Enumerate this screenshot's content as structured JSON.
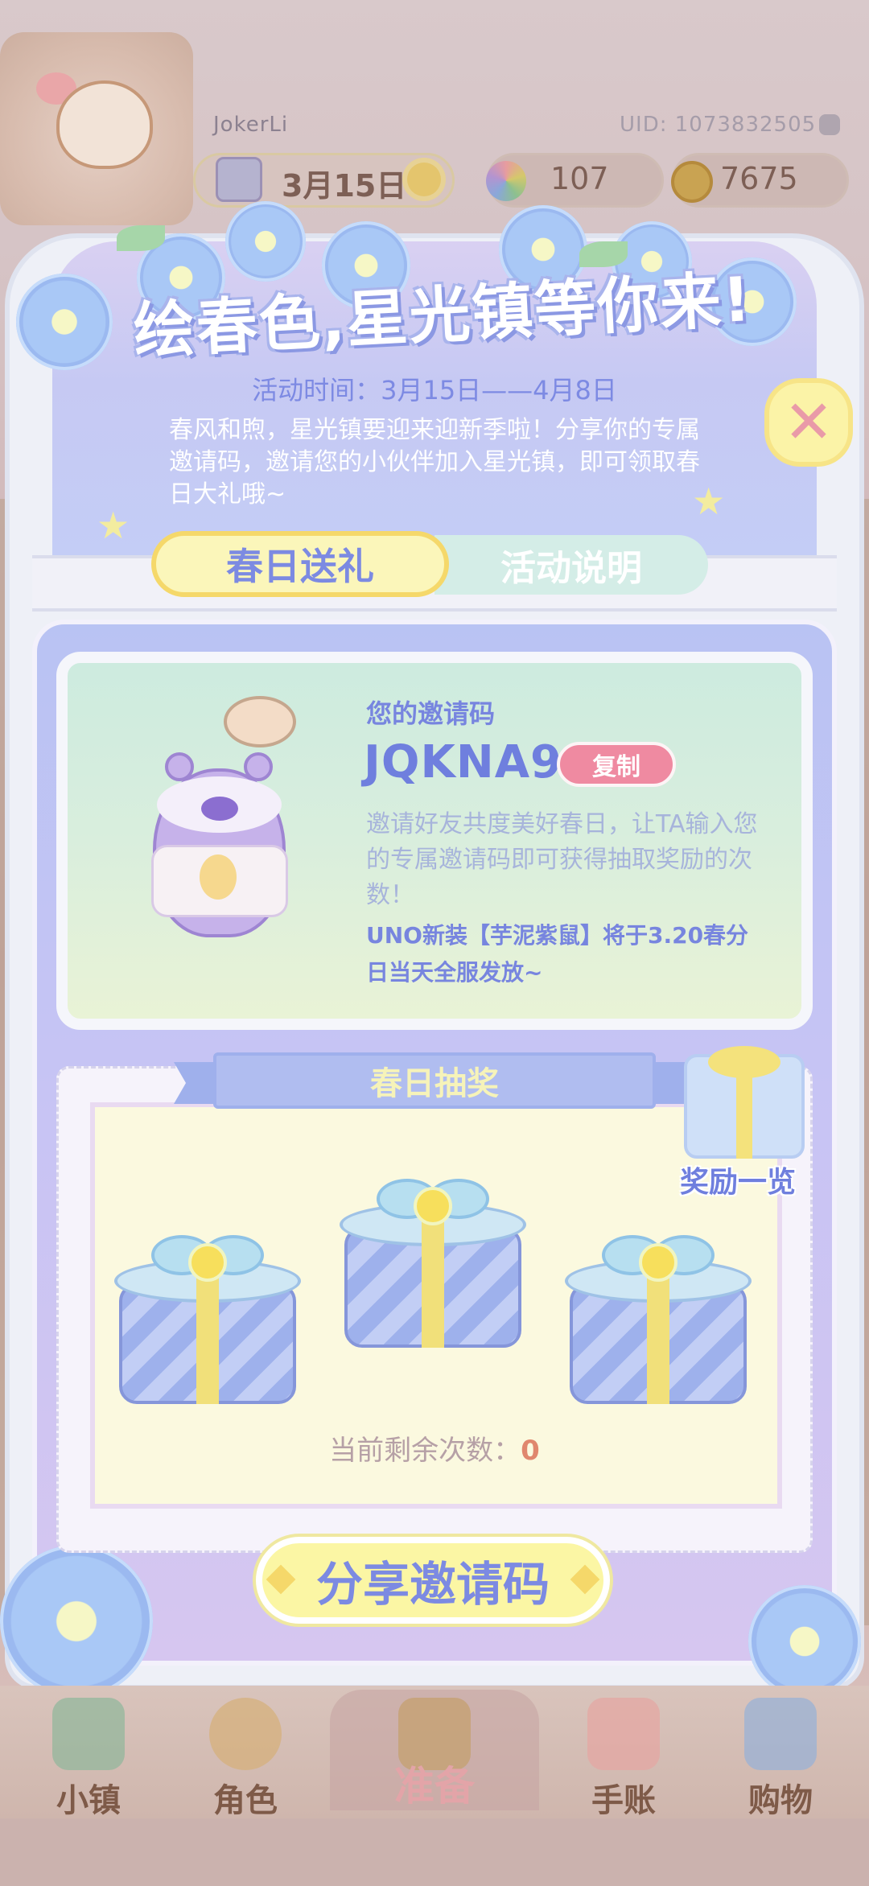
{
  "hud": {
    "username": "JokerLi",
    "uid": "UID: 1073832505",
    "date": "3月15日",
    "gems": "107",
    "coins": "7675"
  },
  "event": {
    "title": "绘春色,星光镇等你来!",
    "time": "活动时间：3月15日——4月8日",
    "description": "春风和煦，星光镇要迎来迎新季啦！分享你的专属邀请码，邀请您的小伙伴加入星光镇，即可领取春日大礼哦~"
  },
  "tabs": [
    {
      "label": "春日送礼",
      "active": true
    },
    {
      "label": "活动说明",
      "active": false
    }
  ],
  "invite": {
    "label": "您的邀请码",
    "code": "JQKNA9",
    "copy_label": "复制",
    "description": "邀请好友共度美好春日，让TA输入您的专属邀请码即可获得抽取奖励的次数！",
    "note": "UNO新装【芋泥紫鼠】将于3.20春分日当天全服发放~"
  },
  "lottery": {
    "title": "春日抽奖",
    "reward_list_label": "奖励一览",
    "remaining_label": "当前剩余次数：",
    "remaining_count": "0"
  },
  "share_button": "分享邀请码",
  "nav": [
    {
      "label": "小镇",
      "icon": "town-icon"
    },
    {
      "label": "角色",
      "icon": "character-icon"
    },
    {
      "label": "准备",
      "icon": "prepare-icon",
      "active": true
    },
    {
      "label": "手账",
      "icon": "journal-icon"
    },
    {
      "label": "购物",
      "icon": "shopping-icon"
    }
  ],
  "colors": {
    "accent": "#6f7fde",
    "button_yellow": "#fbf6a4",
    "copy_pink": "#ef8aa1",
    "panel_purple": "#c6c9f3"
  }
}
